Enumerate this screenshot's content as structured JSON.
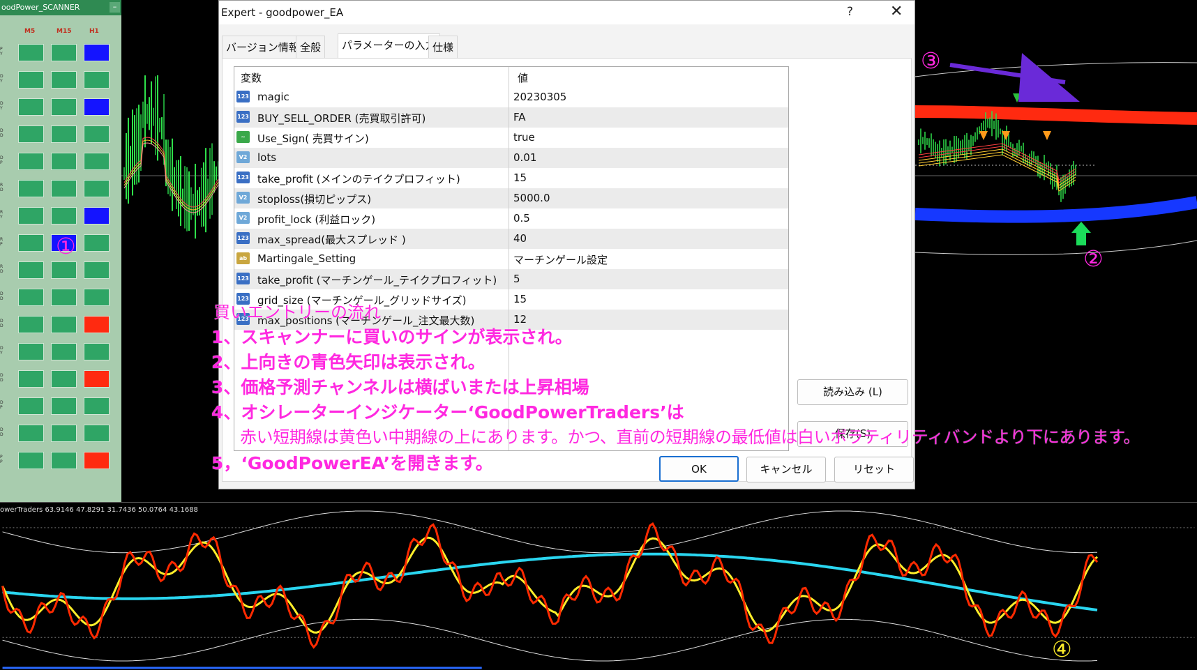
{
  "scanner": {
    "title": "oodPower_SCANNER",
    "min_label": "–",
    "columns": [
      "M5",
      "M15",
      "H1"
    ],
    "row_labels": [
      "P\nY",
      "D\nY",
      "D\nY",
      "D\nD",
      "D\nP",
      "R\nD",
      "R\nY",
      "R\nP",
      "R\nD",
      "D\nD",
      "D\nD",
      "D\nY",
      "D\nD",
      "D\nP",
      "D\nD",
      "P\nP",
      "D\nD"
    ],
    "rows": [
      [
        "green",
        "green",
        "blue"
      ],
      [
        "green",
        "green",
        "green"
      ],
      [
        "green",
        "green",
        "blue"
      ],
      [
        "green",
        "green",
        "green"
      ],
      [
        "green",
        "green",
        "green"
      ],
      [
        "green",
        "green",
        "green"
      ],
      [
        "green",
        "green",
        "blue"
      ],
      [
        "green",
        "blue",
        "green"
      ],
      [
        "green",
        "green",
        "green"
      ],
      [
        "green",
        "green",
        "green"
      ],
      [
        "green",
        "green",
        "red"
      ],
      [
        "green",
        "green",
        "green"
      ],
      [
        "green",
        "green",
        "red"
      ],
      [
        "green",
        "green",
        "green"
      ],
      [
        "green",
        "green",
        "green"
      ],
      [
        "green",
        "green",
        "red"
      ]
    ]
  },
  "dialog": {
    "title": "Expert - goodpower_EA",
    "help": "?",
    "close": "✕",
    "tabs": [
      "バージョン情報",
      "全般",
      "パラメーターの入力",
      "仕様"
    ],
    "active_tab": 2,
    "table": {
      "header": [
        "変数",
        "値"
      ],
      "rows": [
        {
          "icon": "123",
          "name": "magic",
          "value": "20230305"
        },
        {
          "icon": "123",
          "name": "BUY_SELL_ORDER (売買取引許可)",
          "value": "FA"
        },
        {
          "icon": "sign",
          "name": "Use_Sign( 売買サイン)",
          "value": "true"
        },
        {
          "icon": "v2",
          "name": "lots",
          "value": "0.01"
        },
        {
          "icon": "123",
          "name": "take_profit (メインのテイクプロフィット)",
          "value": "15"
        },
        {
          "icon": "v2",
          "name": "stoploss(損切ピップス)",
          "value": "5000.0"
        },
        {
          "icon": "v2",
          "name": "profit_lock (利益ロック)",
          "value": "0.5"
        },
        {
          "icon": "123",
          "name": "max_spread(最大スプレッド )",
          "value": "40"
        },
        {
          "icon": "ab",
          "name": "Martingale_Setting",
          "value": "マーチンゲール設定"
        },
        {
          "icon": "123",
          "name": "take_profit (マーチンゲール_テイクプロフィット)",
          "value": "5"
        },
        {
          "icon": "123",
          "name": "grid_size (マーチンゲール_グリッドサイズ)",
          "value": "15"
        },
        {
          "icon": "123",
          "name": "max_positions (マーチンゲール_注文最大数)",
          "value": "12"
        }
      ]
    },
    "buttons": {
      "load": "読み込み (L)",
      "save": "保存(S)",
      "ok": "OK",
      "cancel": "キャンセル",
      "reset": "リセット"
    }
  },
  "oscillator": {
    "label": "owerTraders 63.9146 47.8291 31.7436 50.0764 43.1688"
  },
  "annotations": {
    "heading": "買いエントリーの流れ",
    "lines": [
      "1、スキャンナーに買いのサインが表示され。",
      "2、上向きの青色矢印は表示され。",
      "3、価格予測チャンネルは横ばいまたは上昇相場",
      "4、オシレーターインジケーター‘GoodPowerTraders’は",
      "赤い短期線は黄色い中期線の上にあります。かつ、直前の短期線の最低値は白いボラティリティバンドより下にあります。",
      "5，‘GoodPowerEA’を開きます。"
    ],
    "markers": [
      "①",
      "②",
      "③",
      "④"
    ]
  },
  "colors": {
    "scanner_green": "#2fa565",
    "scanner_blue": "#1414ff",
    "scanner_red": "#ff2a10",
    "annotation_magenta": "#ff28e0",
    "osc_red": "#ff2a00",
    "osc_yellow": "#ffee2a",
    "osc_cyan": "#2ad6f0"
  }
}
